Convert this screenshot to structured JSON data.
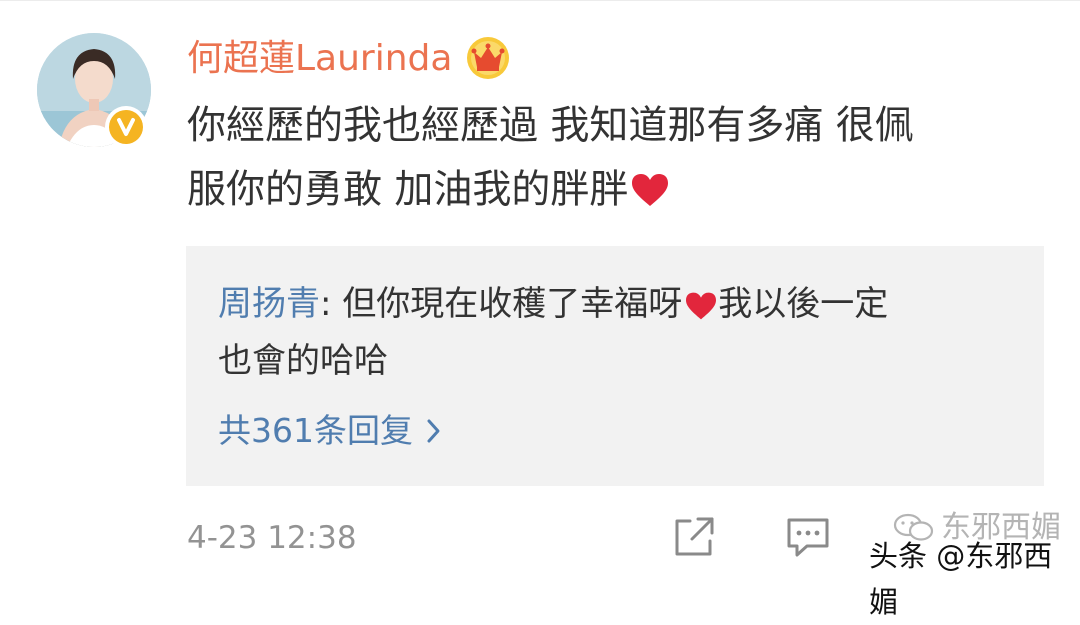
{
  "post": {
    "username": "何超蓮Laurinda",
    "comment_line1": "你經歷的我也經歷過 我知道那有多痛 很佩",
    "comment_line2": "服你的勇敢 加油我的胖胖",
    "timestamp": "4-23 12:38"
  },
  "reply": {
    "author": "周扬青",
    "separator": ": ",
    "text_part1": "但你現在收穫了幸福呀",
    "text_part2": "我以後一定",
    "text_line2": "也會的哈哈",
    "count_label": "共361条回复"
  },
  "watermark": {
    "top_text": "东邪西媚",
    "bottom_text": "头条 @东邪西媚"
  },
  "icons": {
    "crown": "vip-crown-icon",
    "verified": "verified-badge-icon",
    "heart": "heart-emoji-icon",
    "share": "share-icon",
    "comment": "comment-icon",
    "chevron": "chevron-right-icon"
  },
  "colors": {
    "username": "#eb7350",
    "link": "#507daf",
    "reply_bg": "#f2f2f2",
    "meta": "#939393",
    "heart": "#e2263c",
    "verified": "#f5b422"
  }
}
